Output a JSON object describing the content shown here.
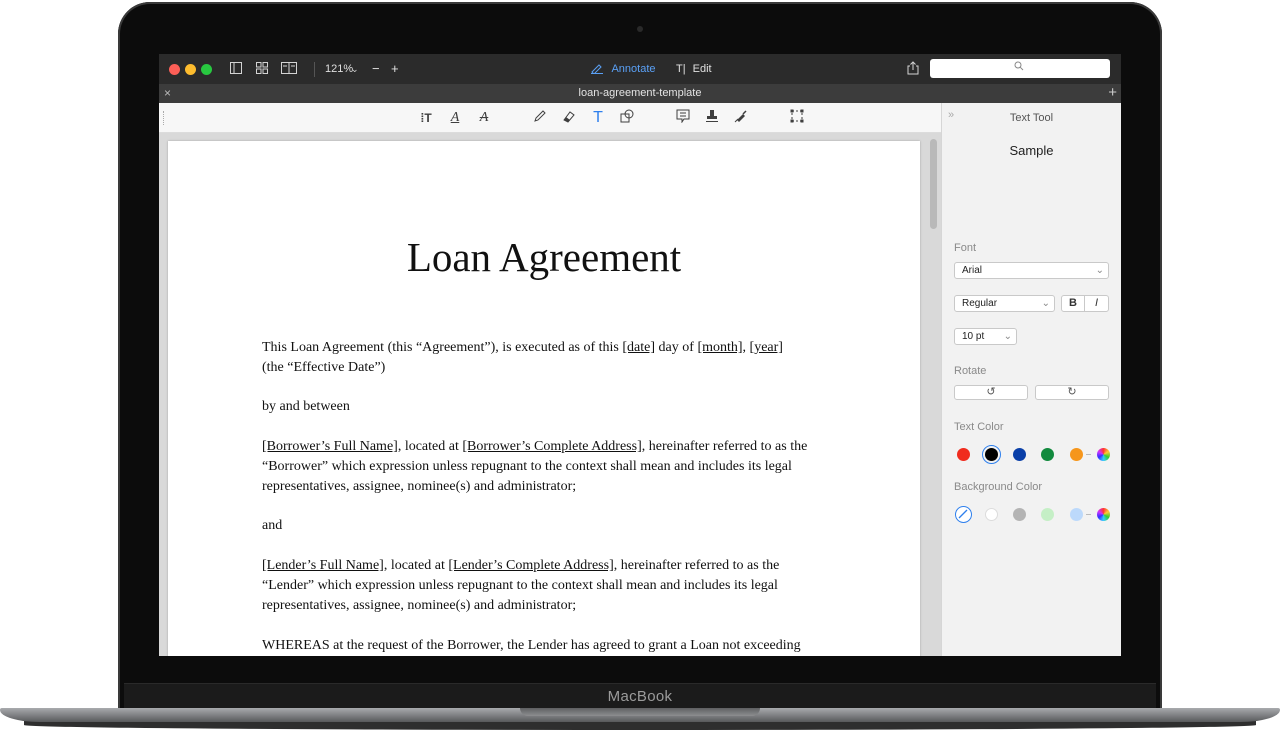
{
  "device": {
    "label": "MacBook"
  },
  "titlebar": {
    "zoom": "121%",
    "zoom_out": "−",
    "zoom_in": "+",
    "annotate_label": "Annotate",
    "edit_label": "Edit"
  },
  "tab": {
    "title": "loan-agreement-template",
    "close": "×",
    "add": "+"
  },
  "document": {
    "title": "Loan Agreement",
    "p1_a": "This Loan Agreement (this “Agreement”), is executed as of this ",
    "p1_date": "[date]",
    "p1_b": " day of ",
    "p1_month": "[month]",
    "p1_c": ", ",
    "p1_year": "[year]",
    "p1_d": "(the “Effective Date”)",
    "p2": "by and between",
    "p3_borrower": "[Borrower’s Full Name]",
    "p3_a": ", located at ",
    "p3_address": "[Borrower’s Complete Address]",
    "p3_b": ", hereinafter referred to as the “Borrower” which expression unless repugnant to the context shall mean and includes its legal representatives, assignee, nominee(s) and administrator;",
    "p4": "and",
    "p5_lender": "[Lender’s Full Name]",
    "p5_a": ", located at ",
    "p5_address": "[Lender’s Complete Address]",
    "p5_b": ", hereinafter referred to as the “Lender” which expression unless repugnant to the context shall mean and includes its legal representatives, assignee, nominee(s) and administrator;",
    "p6": "WHEREAS at the request of the Borrower, the Lender has agreed to grant a Loan not exceeding"
  },
  "panel": {
    "title": "Text Tool",
    "sample": "Sample",
    "font_label": "Font",
    "font_value": "Arial",
    "style_value": "Regular",
    "bold": "B",
    "italic": "I",
    "size_value": "10 pt",
    "rotate_label": "Rotate",
    "text_color_label": "Text Color",
    "bg_color_label": "Background Color"
  },
  "colors": {
    "text_swatches": [
      "#f02c1e",
      "#000000",
      "#0a3fa8",
      "#128a3e",
      "#f6961b"
    ],
    "bg_swatches": [
      "#ffffff",
      "#b4b4b4",
      "#c5efc6",
      "#bcd9fb"
    ],
    "selected_text_color": "#000000",
    "accent": "#2f80ed"
  },
  "icons": {
    "toolbar": [
      "text-select-icon",
      "text-underline-icon",
      "text-strikethrough-icon",
      "pencil-icon",
      "eraser-icon",
      "text-tool-icon",
      "shapes-icon",
      "note-icon",
      "stamp-icon",
      "signature-pen-icon",
      "crop-select-icon"
    ]
  }
}
